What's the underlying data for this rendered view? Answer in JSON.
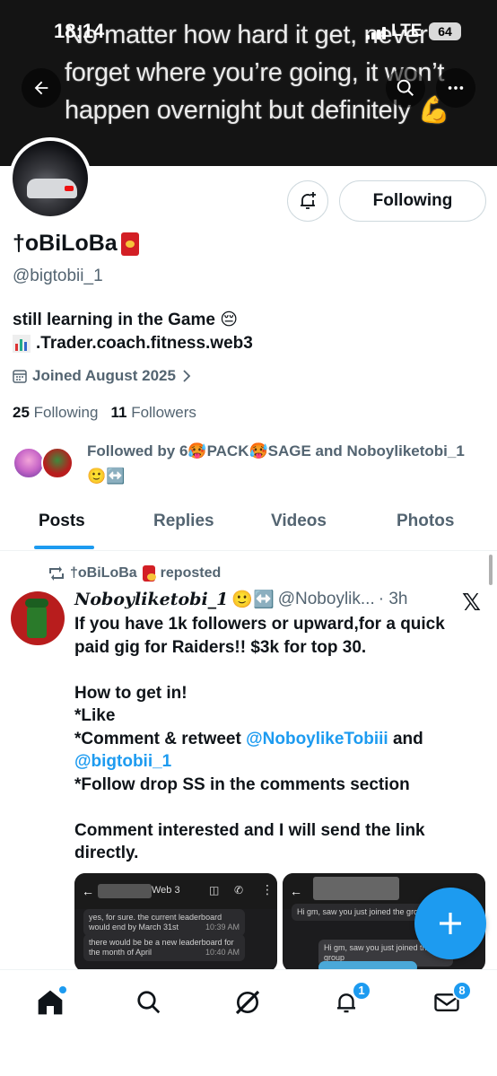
{
  "status": {
    "time": "18:14",
    "network": "LTE",
    "battery": "64"
  },
  "banner": {
    "text": "No matter how hard it get, never forget where you’re going, it won’t happen overnight but definitely 💪"
  },
  "profile": {
    "display_name": "†oBiLoBa",
    "handle": "@bigtobii_1",
    "bio_line1": "still learning in the Game 😔",
    "bio_line2": ".Trader.coach.fitness.web3",
    "joined": "Joined August 2025",
    "following_count": "25",
    "following_label": "Following",
    "followers_count": "11",
    "followers_label": "Followers",
    "followed_by": "Followed by 6🥵PACK🥵SAGE and Noboyliketobi_1 🙂↔️",
    "follow_button": "Following"
  },
  "tabs": [
    "Posts",
    "Replies",
    "Videos",
    "Photos"
  ],
  "post": {
    "repost_label": "†oBiLoBa",
    "repost_suffix": "reposted",
    "author": "Noboyliketobi_1",
    "author_emoji": "🙂↔️",
    "author_handle": "@Noboylik...",
    "time": "· 3h",
    "line1": "If you have 1k followers or upward,for a quick paid gig for Raiders!! $3k for top 30.",
    "line2": "How to get in!",
    "line3": "*Like",
    "line4_pre": "*Comment & retweet ",
    "line4_link": "@NoboylikeTobiii",
    "line4_post": " and",
    "line5_link": "@bigtobii_1",
    "line6": "*Follow drop SS in the comments section",
    "line7": "Comment interested and I will send the link directly.",
    "media1": {
      "header": "Web 3",
      "msg1": "yes, for sure. the current leaderboard would end by March 31st",
      "msg1_time": "10:39 AM",
      "msg2": "there would be be a  new leaderboard for the month of April",
      "msg2_time": "10:40 AM"
    },
    "media2": {
      "msg1": "Hi gm, saw you just joined the group",
      "msg2": "Hi gm, saw you just joined the group"
    }
  },
  "nav": {
    "notifications_badge": "1",
    "messages_badge": "8"
  },
  "colors": {
    "accent": "#1d9bf0",
    "text": "#0f1419",
    "muted": "#536471"
  }
}
